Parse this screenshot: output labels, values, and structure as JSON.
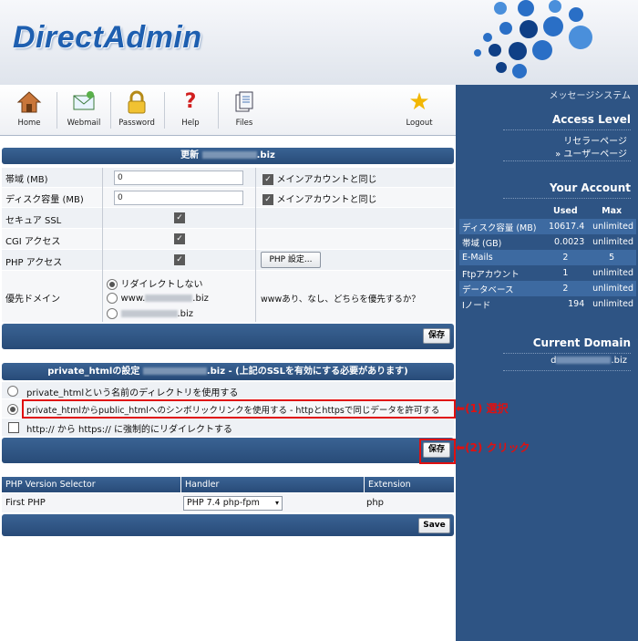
{
  "header": {
    "logo": "DirectAdmin"
  },
  "toolbar": {
    "home": "Home",
    "webmail": "Webmail",
    "password": "Password",
    "help": "Help",
    "files": "Files",
    "logout": "Logout"
  },
  "sidebar": {
    "message_system": "メッセージシステム",
    "access_level_title": "Access Level",
    "reseller_page": "リセラーページ",
    "user_page": "» ユーザーページ",
    "your_account_title": "Your Account",
    "col_used": "Used",
    "col_max": "Max",
    "stats": [
      {
        "label": "ディスク容量 (MB)",
        "used": "10617.4",
        "max": "unlimited"
      },
      {
        "label": "帯域 (GB)",
        "used": "0.0023",
        "max": "unlimited"
      },
      {
        "label": "E-Mails",
        "used": "2",
        "max": "5"
      },
      {
        "label": "Ftpアカウント",
        "used": "1",
        "max": "unlimited"
      },
      {
        "label": "データベース",
        "used": "2",
        "max": "unlimited"
      },
      {
        "label": "Iノード",
        "used": "194",
        "max": "unlimited"
      }
    ],
    "current_domain_title": "Current Domain",
    "current_domain_prefix": "d",
    "current_domain_suffix": ".biz"
  },
  "update": {
    "title_prefix": "更新",
    "title_suffix": ".biz",
    "bandwidth_label": "帯域 (MB)",
    "bandwidth_value": "0",
    "disk_label": "ディスク容量 (MB)",
    "disk_value": "0",
    "same_as_main": "メインアカウントと同じ",
    "ssl_label": "セキュア SSL",
    "cgi_label": "CGI アクセス",
    "php_label": "PHP アクセス",
    "php_settings_button": "PHP 設定...",
    "priority_label": "優先ドメイン",
    "opt_no_redirect": "リダイレクトしない",
    "opt_www_prefix": "www.",
    "opt_www_suffix": ".biz",
    "opt_plain_suffix": ".biz",
    "priority_help": "wwwあり、なし、どちらを優先するか？",
    "save_button": "保存"
  },
  "private_html": {
    "title_prefix": "private_htmlの設定",
    "title_suffix": ".biz - (上記のSSLを有効にする必要があります)",
    "opt_directory": "private_htmlという名前のディレクトリを使用する",
    "opt_symlink": "private_htmlからpublic_htmlへのシンボリックリンクを使用する - httpとhttpsで同じデータを許可する",
    "opt_force_https": "http:// から https:// に強制的にリダイレクトする",
    "annotation_select": "(1) 選択",
    "annotation_click": "(2) クリック",
    "save_button": "保存"
  },
  "php_selector": {
    "col_version_selector": "PHP Version Selector",
    "col_handler": "Handler",
    "col_extension": "Extension",
    "row_label": "First PHP",
    "handler_value": "PHP 7.4 php-fpm",
    "extension_value": "php",
    "save_button": "Save"
  },
  "colors": {
    "accent": "#2e5484",
    "annotation": "#e01010"
  }
}
